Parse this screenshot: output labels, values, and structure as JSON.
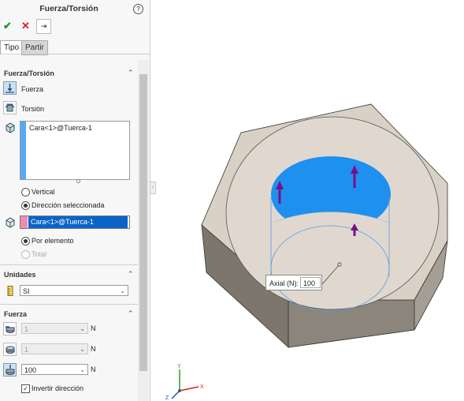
{
  "header": {
    "title": "Fuerza/Torsión",
    "help_glyph": "?"
  },
  "toolbar": {
    "ok_glyph": "✔",
    "cancel_glyph": "✕",
    "pin_glyph": "⇥"
  },
  "tabs": [
    {
      "label": "Tipo",
      "active": true
    },
    {
      "label": "Partir",
      "active": false
    }
  ],
  "fuerza_torsion": {
    "heading": "Fuerza/Torsión",
    "fuerza_label": "Fuerza",
    "torsion_label": "Torsión",
    "faces_list": [
      "Cara<1>@Tuerca-1"
    ],
    "vertical_label": "Vertical",
    "direccion_label": "Dirección seleccionada",
    "direccion_value": "Cara<1>@Tuerca-1",
    "por_elemento_label": "Por elemento",
    "total_label": "Total"
  },
  "unidades": {
    "heading": "Unidades",
    "value": "SI"
  },
  "fuerza": {
    "heading": "Fuerza",
    "rows": [
      {
        "value": "1",
        "unit": "N",
        "enabled": false
      },
      {
        "value": "1",
        "unit": "N",
        "enabled": false
      },
      {
        "value": "100",
        "unit": "N",
        "enabled": true
      }
    ],
    "invertir_label": "Invertir dirección",
    "invertir_checked": true
  },
  "viewport": {
    "axial_label": "Axial (N):",
    "axial_value": "100"
  },
  "triad": {
    "x": "X",
    "y": "Y",
    "z": "Z"
  },
  "colors": {
    "face_blue": "#1e90f0",
    "arrow_purple": "#7a0f8a",
    "nut_top": "#ddd3c8",
    "nut_side": "#8a8378",
    "selection_blue": "#0a64c8"
  }
}
